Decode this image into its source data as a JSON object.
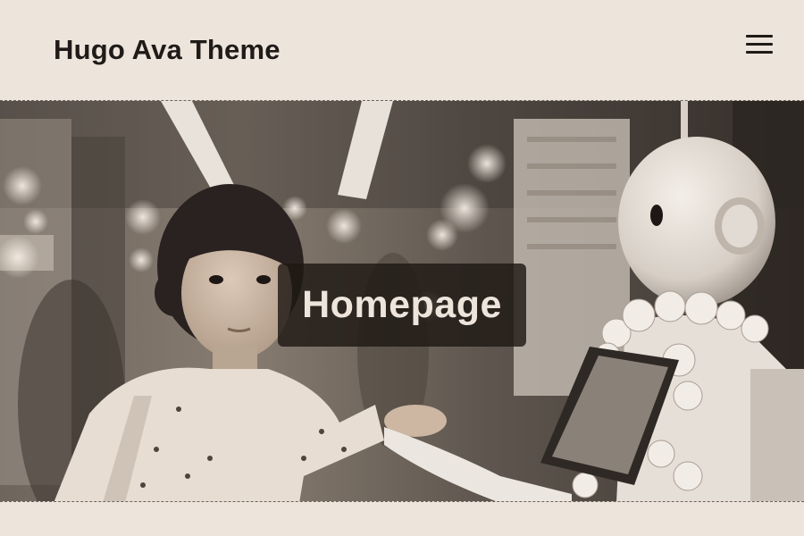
{
  "header": {
    "site_title": "Hugo Ava Theme",
    "menu_icon": "hamburger-menu-icon"
  },
  "hero": {
    "title": "Homepage",
    "image_description_icon": "hero-photo"
  },
  "colors": {
    "background": "#ede4db",
    "text": "#1f1b18",
    "overlay": "#1e1814"
  }
}
